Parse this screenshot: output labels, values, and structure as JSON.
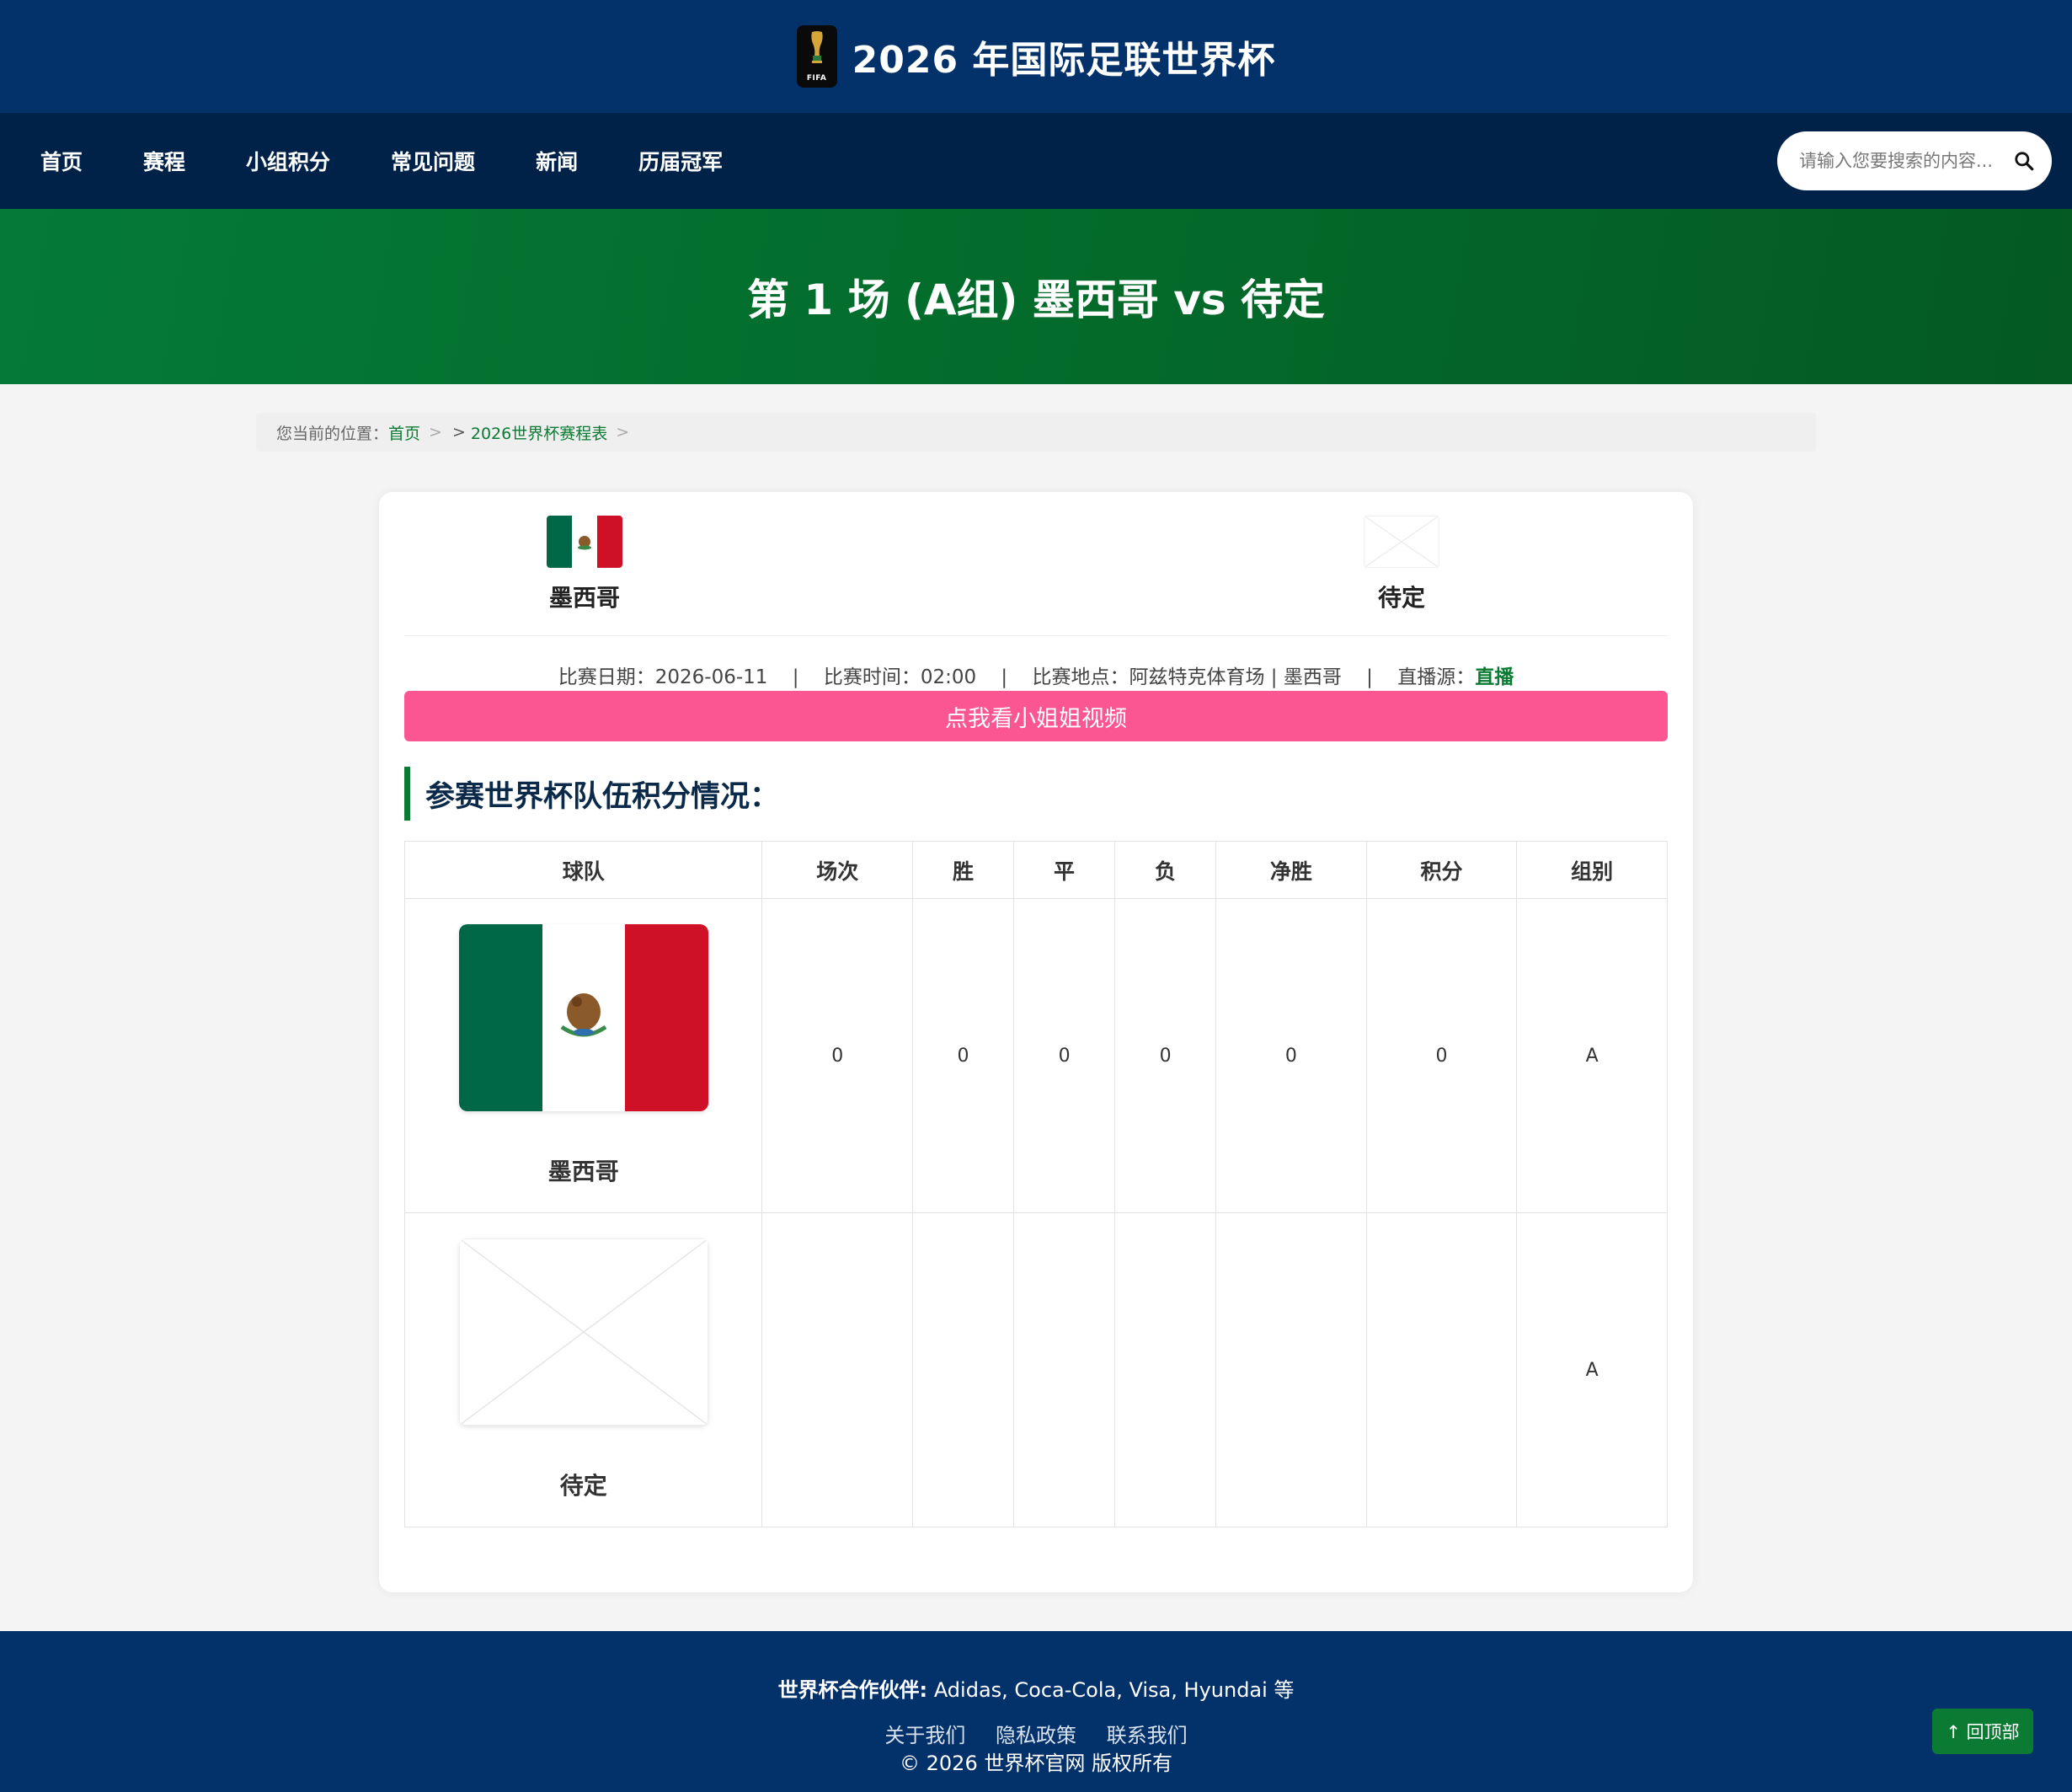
{
  "header": {
    "title": "2026 年国际足联世界杯",
    "logo_text": "FIFA"
  },
  "nav": {
    "items": [
      "首页",
      "赛程",
      "小组积分",
      "常见问题",
      "新闻",
      "历届冠军"
    ],
    "search_placeholder": "请输入您要搜索的内容..."
  },
  "hero": {
    "title": "第 1 场 (A组) 墨西哥 vs 待定"
  },
  "breadcrumb": {
    "prefix": "您当前的位置：",
    "home": "首页",
    "sep": ">",
    "schedule": "2026世界杯赛程表"
  },
  "match": {
    "home_team": "墨西哥",
    "away_team": "待定",
    "date_label": "比赛日期：",
    "date": "2026-06-11",
    "time_label": "比赛时间：",
    "time": "02:00",
    "venue_label": "比赛地点：",
    "venue": "阿兹特克体育场 | 墨西哥",
    "stream_label": "直播源：",
    "stream_link": "直播",
    "divider": "|"
  },
  "video_button": "点我看小姐姐视频",
  "standings": {
    "title": "参赛世界杯队伍积分情况：",
    "headers": [
      "球队",
      "场次",
      "胜",
      "平",
      "负",
      "净胜",
      "积分",
      "组别"
    ],
    "rows": [
      {
        "team": "墨西哥",
        "played": "0",
        "won": "0",
        "drawn": "0",
        "lost": "0",
        "gd": "0",
        "points": "0",
        "group": "A"
      },
      {
        "team": "待定",
        "played": "",
        "won": "",
        "drawn": "",
        "lost": "",
        "gd": "",
        "points": "",
        "group": "A"
      }
    ]
  },
  "footer": {
    "partners_label": "世界杯合作伙伴:",
    "partners": "Adidas, Coca-Cola, Visa, Hyundai 等",
    "links": [
      "关于我们",
      "隐私政策",
      "联系我们"
    ],
    "copyright": "© 2026 世界杯官网 版权所有"
  },
  "back_to_top": "↑ 回顶部",
  "colors": {
    "header_bg": "#03316a",
    "nav_bg": "#002148",
    "hero_green": "#047a36",
    "accent_green": "#0b7a33",
    "video_pink": "#fb5592",
    "mexico_green": "#006847",
    "mexico_red": "#ce1126"
  },
  "icons": [
    "trophy-logo-icon",
    "search-icon",
    "mexico-flag-icon",
    "placeholder-image-icon"
  ]
}
